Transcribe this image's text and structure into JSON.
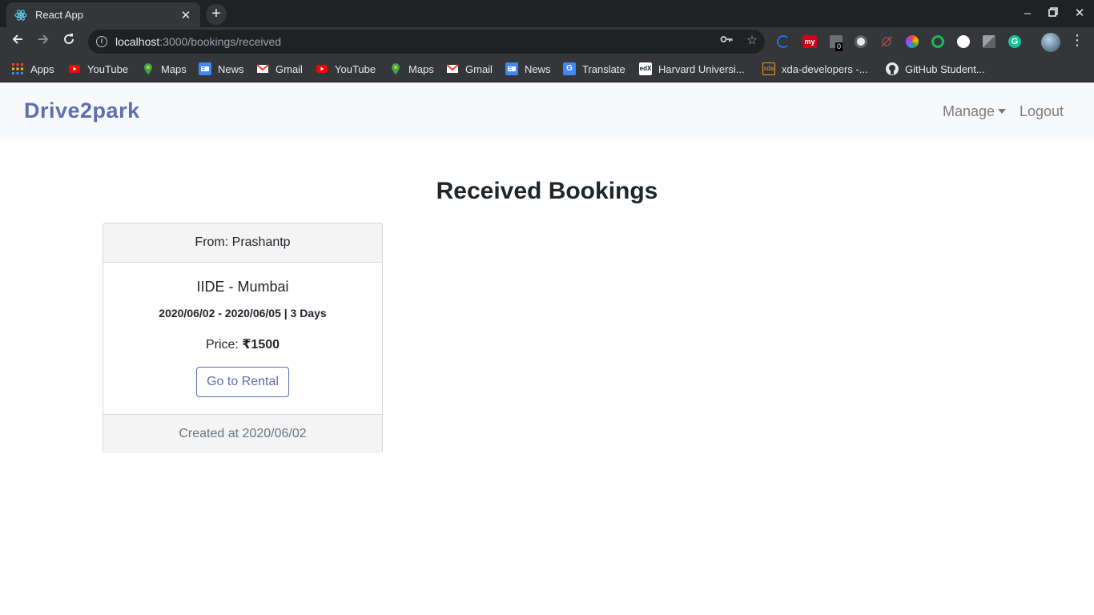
{
  "browser": {
    "tab_title": "React App",
    "tab_close": "✕",
    "new_tab": "+",
    "url_host": "localhost",
    "url_path": ":3000/bookings/received",
    "bookmarks": [
      {
        "label": "Apps",
        "icon": "apps-grid-icon",
        "color": "#4285f4"
      },
      {
        "label": "YouTube",
        "icon": "youtube-icon",
        "color": "#ff0000"
      },
      {
        "label": "Maps",
        "icon": "maps-pin-icon",
        "color": "#34a853"
      },
      {
        "label": "News",
        "icon": "google-news-icon",
        "color": "#4285f4"
      },
      {
        "label": "Gmail",
        "icon": "gmail-icon",
        "color": "#ea4335"
      },
      {
        "label": "YouTube",
        "icon": "youtube-icon",
        "color": "#ff0000"
      },
      {
        "label": "Maps",
        "icon": "maps-pin-icon",
        "color": "#34a853"
      },
      {
        "label": "Gmail",
        "icon": "gmail-icon",
        "color": "#ea4335"
      },
      {
        "label": "News",
        "icon": "google-news-icon",
        "color": "#4285f4"
      },
      {
        "label": "Translate",
        "icon": "google-translate-icon",
        "color": "#4285f4"
      },
      {
        "label": "Harvard Universi...",
        "icon": "edx-icon",
        "color": "#ffffff"
      },
      {
        "label": "xda-developers -...",
        "icon": "xda-icon",
        "color": "#f59714"
      },
      {
        "label": "GitHub Student...",
        "icon": "github-icon",
        "color": "#ffffff"
      }
    ],
    "extension_badge": "0"
  },
  "navbar": {
    "brand": "Drive2park",
    "manage": "Manage",
    "logout": "Logout"
  },
  "page": {
    "title": "Received Bookings"
  },
  "booking": {
    "from": "From: Prashantp",
    "place": "IIDE - Mumbai",
    "dates": "2020/06/02 - 2020/06/05 | 3 Days",
    "price_label": "Price: ",
    "price_value": "₹1500",
    "button": "Go to Rental",
    "created": "Created at 2020/06/02"
  },
  "colors": {
    "brand": "#5c6fb0",
    "chrome_dark": "#202124",
    "chrome_tab": "#35363a"
  }
}
